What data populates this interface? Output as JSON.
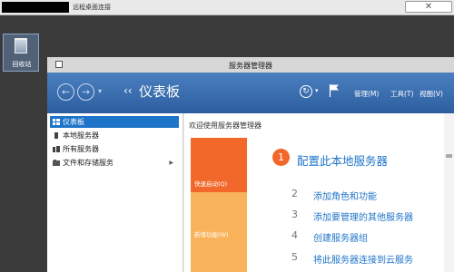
{
  "outer_window": {
    "title": "远程桌面连接",
    "close_glyph": "✕"
  },
  "desktop": {
    "recycle_bin_label": "回收站"
  },
  "server_manager": {
    "title": "服务器管理器",
    "nav": {
      "back_glyph": "←",
      "forward_glyph": "→",
      "dropdown_glyph": "▾"
    },
    "breadcrumb": {
      "arrows": "‹‹",
      "title": "仪表板"
    },
    "refresh_glyph": "↻",
    "toolbar_dropdown_glyph": "▾",
    "menu": [
      "管理(M)",
      "工具(T)",
      "视图(V)"
    ]
  },
  "sidebar": {
    "items": [
      {
        "label": "仪表板",
        "selected": true,
        "icon": "dashboard-icon"
      },
      {
        "label": "本地服务器",
        "selected": false,
        "icon": "server-icon"
      },
      {
        "label": "所有服务器",
        "selected": false,
        "icon": "servers-icon"
      },
      {
        "label": "文件和存储服务",
        "selected": false,
        "icon": "storage-icon",
        "expand_glyph": "▶"
      }
    ]
  },
  "content": {
    "welcome": "欢迎使用服务器管理器",
    "quick_start": "快速启动(Q)",
    "new_features": "新增功能(W)",
    "steps": [
      {
        "number": "1",
        "label": "配置此本地服务器"
      },
      {
        "number": "2",
        "label": "添加角色和功能"
      },
      {
        "number": "3",
        "label": "添加要管理的其他服务器"
      },
      {
        "number": "4",
        "label": "创建服务器组"
      },
      {
        "number": "5",
        "label": "将此服务器连接到云服务"
      }
    ]
  },
  "colors": {
    "accent_blue": "#1e74c8",
    "quick_orange": "#f2682a",
    "new_orange": "#f9b35a"
  }
}
